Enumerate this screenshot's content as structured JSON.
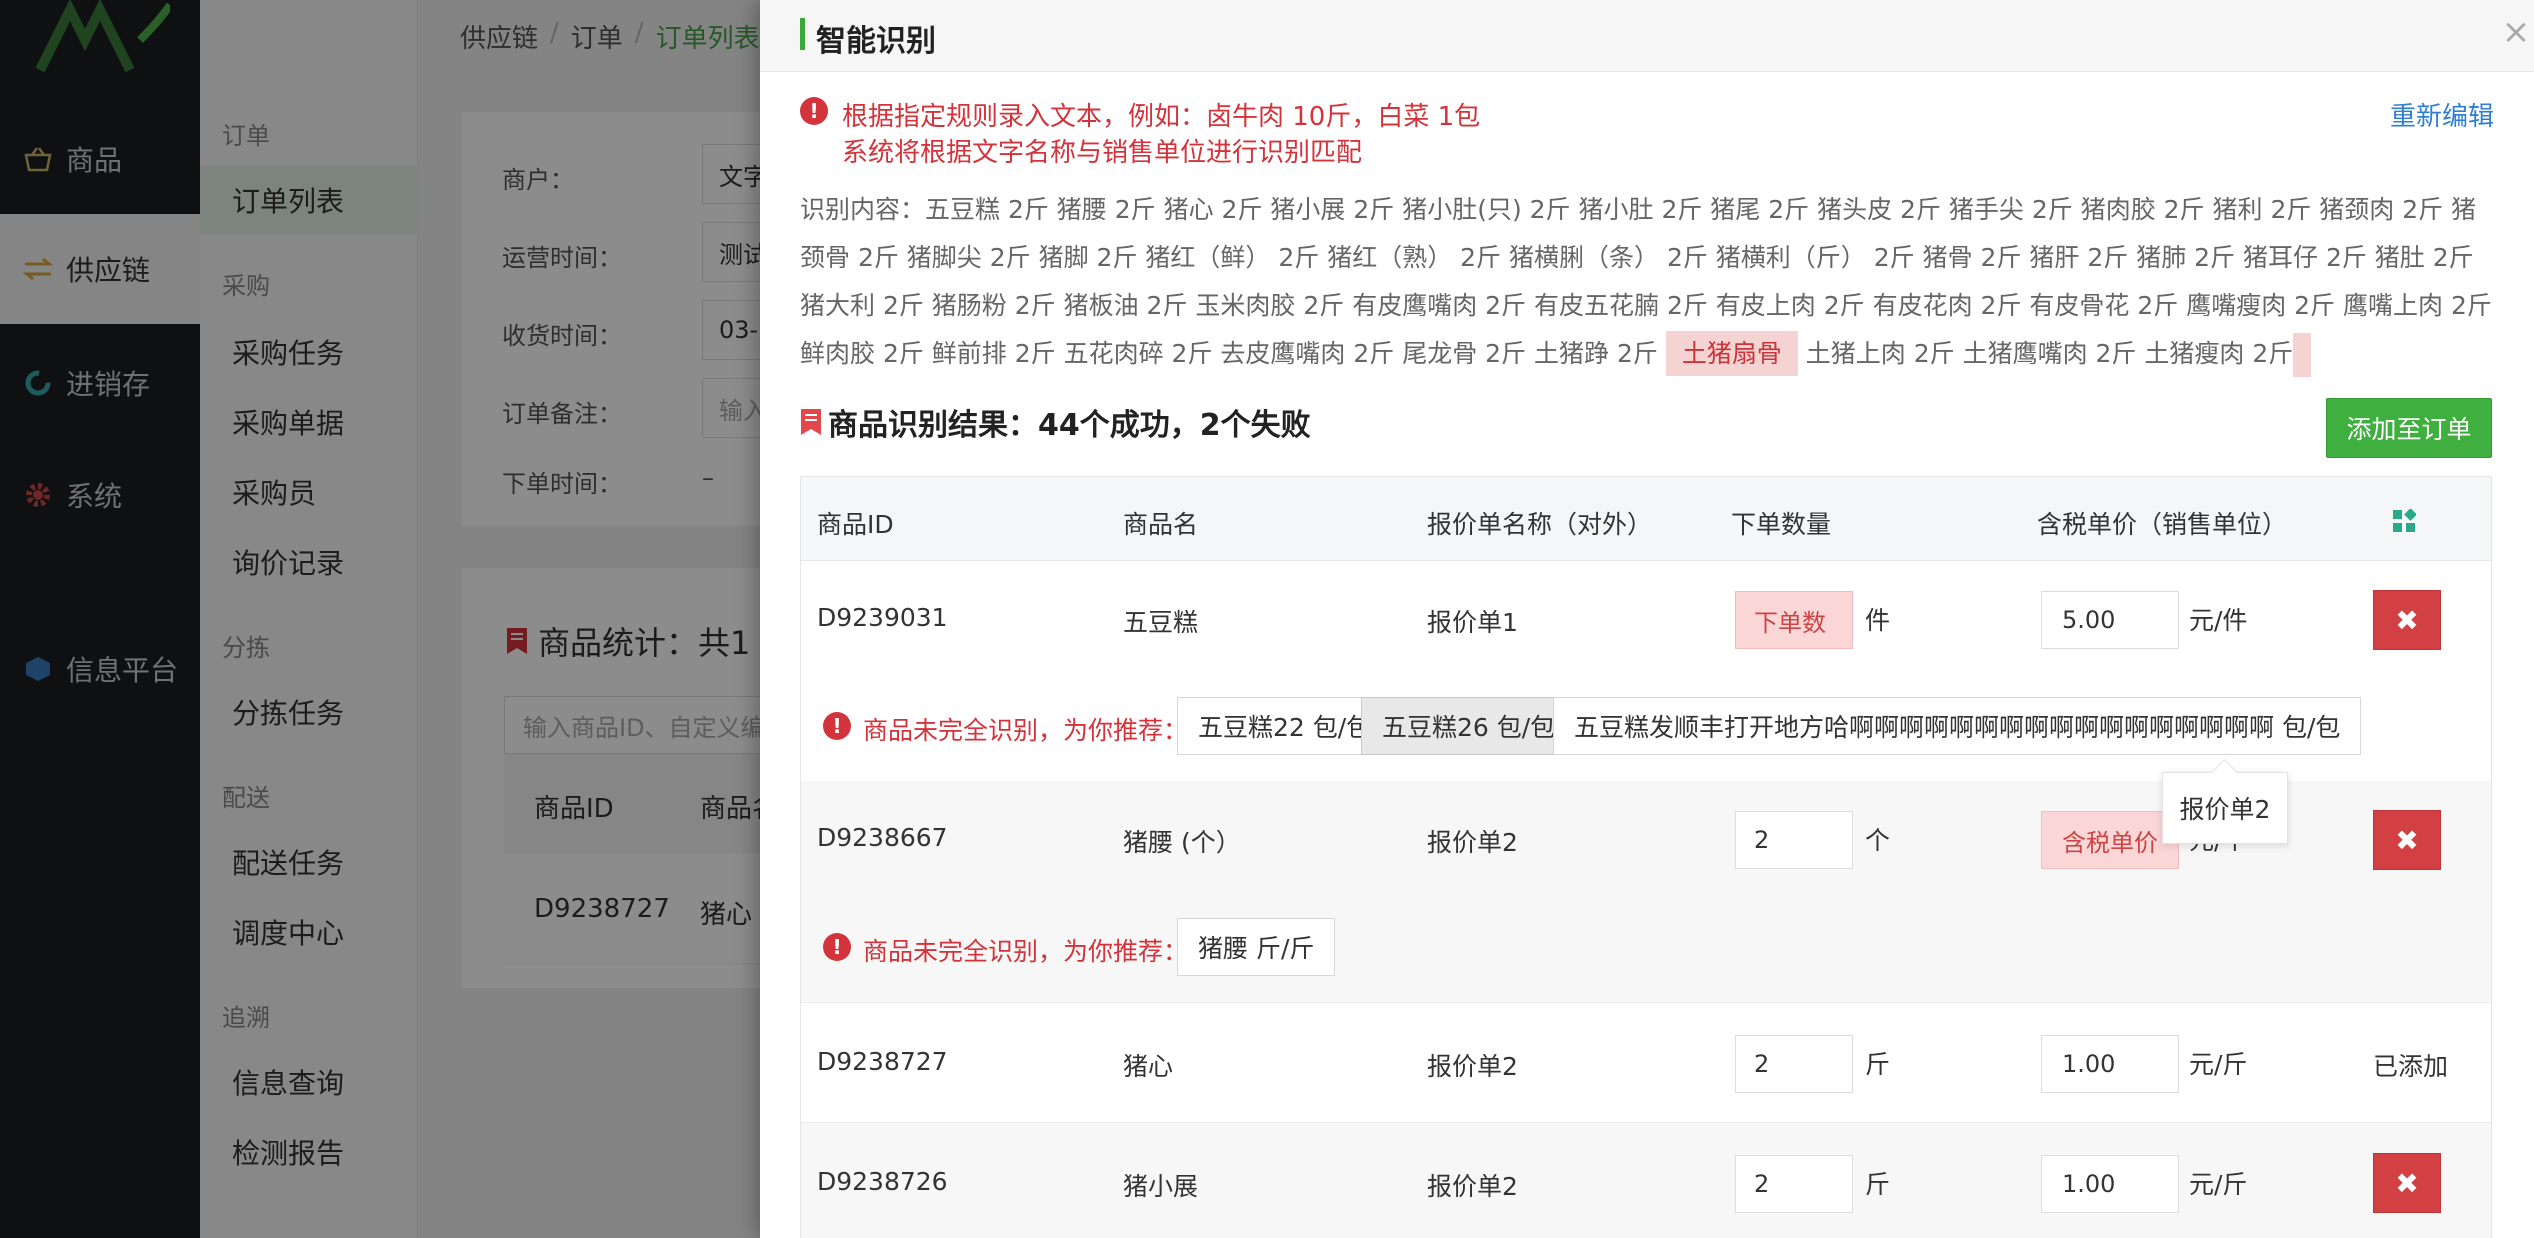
{
  "nav": {
    "items": [
      {
        "label": "商品",
        "icon": "basket-icon"
      },
      {
        "label": "供应链",
        "icon": "exchange-icon"
      },
      {
        "label": "进销存",
        "icon": "refresh-icon"
      },
      {
        "label": "系统",
        "icon": "gear-icon"
      },
      {
        "label": "信息平台",
        "icon": "cube-icon"
      }
    ]
  },
  "subnav": {
    "groups": [
      "订单",
      "采购",
      "分拣",
      "配送",
      "追溯"
    ],
    "items": [
      "订单列表",
      "采购任务",
      "采购单据",
      "采购员",
      "询价记录",
      "分拣任务",
      "配送任务",
      "调度中心",
      "信息查询",
      "检测报告"
    ]
  },
  "breadcrumb": [
    "供应链",
    "订单",
    "订单列表"
  ],
  "form": {
    "merchant_label": "商户：",
    "merchant_value": "文字",
    "ops_time_label": "运营时间：",
    "ops_time_value": "测试",
    "receive_time_label": "收货时间：",
    "receive_time_value": "03-",
    "remark_label": "订单备注：",
    "remark_placeholder": "输入",
    "order_time_label": "下单时间：",
    "order_time_value": "–"
  },
  "stats": {
    "title": "商品统计：共1",
    "search_placeholder": "输入商品ID、自定义编",
    "col_id": "商品ID",
    "col_name": "商品名",
    "row_id": "D9238727",
    "row_name": "猪心"
  },
  "drawer": {
    "title": "智能识别",
    "hint_1": "根据指定规则录入文本，例如：卤牛肉 10斤，白菜 1包",
    "hint_2": "系统将根据文字名称与销售单位进行识别匹配",
    "re_edit": "重新编辑",
    "recog_prefix": "识别内容：五豆糕 2斤 猪腰 2斤 猪心 2斤 猪小展 2斤 猪小肚(只) 2斤 猪小肚 2斤 猪尾 2斤 猪头皮 2斤 猪手尖 2斤 猪肉胶 2斤 猪利 2斤 猪颈肉 2斤 猪颈骨 2斤 猪脚尖 2斤 猪脚 2斤 猪红（鲜） 2斤 猪红（熟） 2斤 猪横脷（条） 2斤 猪横利（斤） 2斤 猪骨 2斤 猪肝 2斤 猪肺 2斤 猪耳仔 2斤 猪肚 2斤 猪大利 2斤 猪肠粉 2斤 猪板油 2斤 玉米肉胶 2斤 有皮鹰嘴肉 2斤 有皮五花腩 2斤 有皮上肉 2斤 有皮花肉 2斤 有皮骨花 2斤 鹰嘴瘦肉 2斤 鹰嘴上肉 2斤 鲜肉胶 2斤 鲜前排 2斤 五花肉碎 2斤 去皮鹰嘴肉 2斤 尾龙骨 2斤 土猪踭 2斤",
    "recog_highlight": "土猪扇骨",
    "recog_suffix": "土猪上肉 2斤 土猪鹰嘴肉 2斤 土猪瘦肉 2斤",
    "result_title": "商品识别结果：44个成功，2个失败",
    "add_button": "添加至订单"
  },
  "table": {
    "headers": [
      "商品ID",
      "商品名",
      "报价单名称（对外）",
      "下单数量",
      "含税单价（销售单位）"
    ],
    "qty_placeholder": "下单数",
    "price_placeholder": "含税单价",
    "rows": [
      {
        "id": "D9239031",
        "name": "五豆糕",
        "quote": "报价单1",
        "qty": "",
        "qty_unit": "件",
        "price": "5.00",
        "price_unit": "元/件",
        "action": "delete"
      },
      {
        "id": "D9238667",
        "name": "猪腰 (个）",
        "quote": "报价单2",
        "qty": "2",
        "qty_unit": "个",
        "price": "",
        "price_unit": "元/个",
        "action": "delete"
      },
      {
        "id": "D9238727",
        "name": "猪心",
        "quote": "报价单2",
        "qty": "2",
        "qty_unit": "斤",
        "price": "1.00",
        "price_unit": "元/斤",
        "action": "已添加"
      },
      {
        "id": "D9238726",
        "name": "猪小展",
        "quote": "报价单2",
        "qty": "2",
        "qty_unit": "斤",
        "price": "1.00",
        "price_unit": "元/斤",
        "action": "delete"
      }
    ],
    "suggest_label": "商品未完全识别，为你推荐：",
    "suggest_1": [
      "五豆糕22 包/包",
      "五豆糕26 包/包",
      "五豆糕发顺丰打开地方哈啊啊啊啊啊啊啊啊啊啊啊啊啊啊啊啊啊 包/包"
    ],
    "suggest_2": [
      "猪腰 斤/斤"
    ],
    "tooltip": "报价单2"
  },
  "colors": {
    "accent_green": "#3faf3f",
    "error_red": "#d3333a",
    "link_blue": "#2e7fd2",
    "delete_red": "#d24043"
  }
}
